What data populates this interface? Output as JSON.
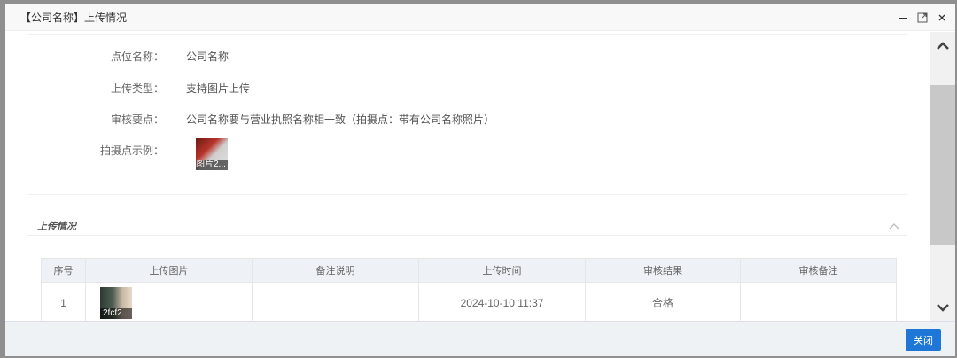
{
  "dialog": {
    "title": "【公司名称】上传情况",
    "close_label": "关闭"
  },
  "info": {
    "rows": [
      {
        "label": "点位名称：",
        "value": "公司名称"
      },
      {
        "label": "上传类型：",
        "value": "支持图片上传"
      },
      {
        "label": "审核要点：",
        "value": "公司名称要与营业执照名称相一致（拍摄点：带有公司名称照片）"
      },
      {
        "label": "拍摄点示例：",
        "image_caption": "图片2..."
      }
    ]
  },
  "upload": {
    "section_title": "上传情况",
    "columns": [
      "序号",
      "上传图片",
      "备注说明",
      "上传时间",
      "审核结果",
      "审核备注"
    ],
    "rows": [
      {
        "index": "1",
        "image_caption": "2fcf2...",
        "note": "",
        "time": "2024-10-10 11:37",
        "result": "合格",
        "review_note": ""
      }
    ]
  }
}
